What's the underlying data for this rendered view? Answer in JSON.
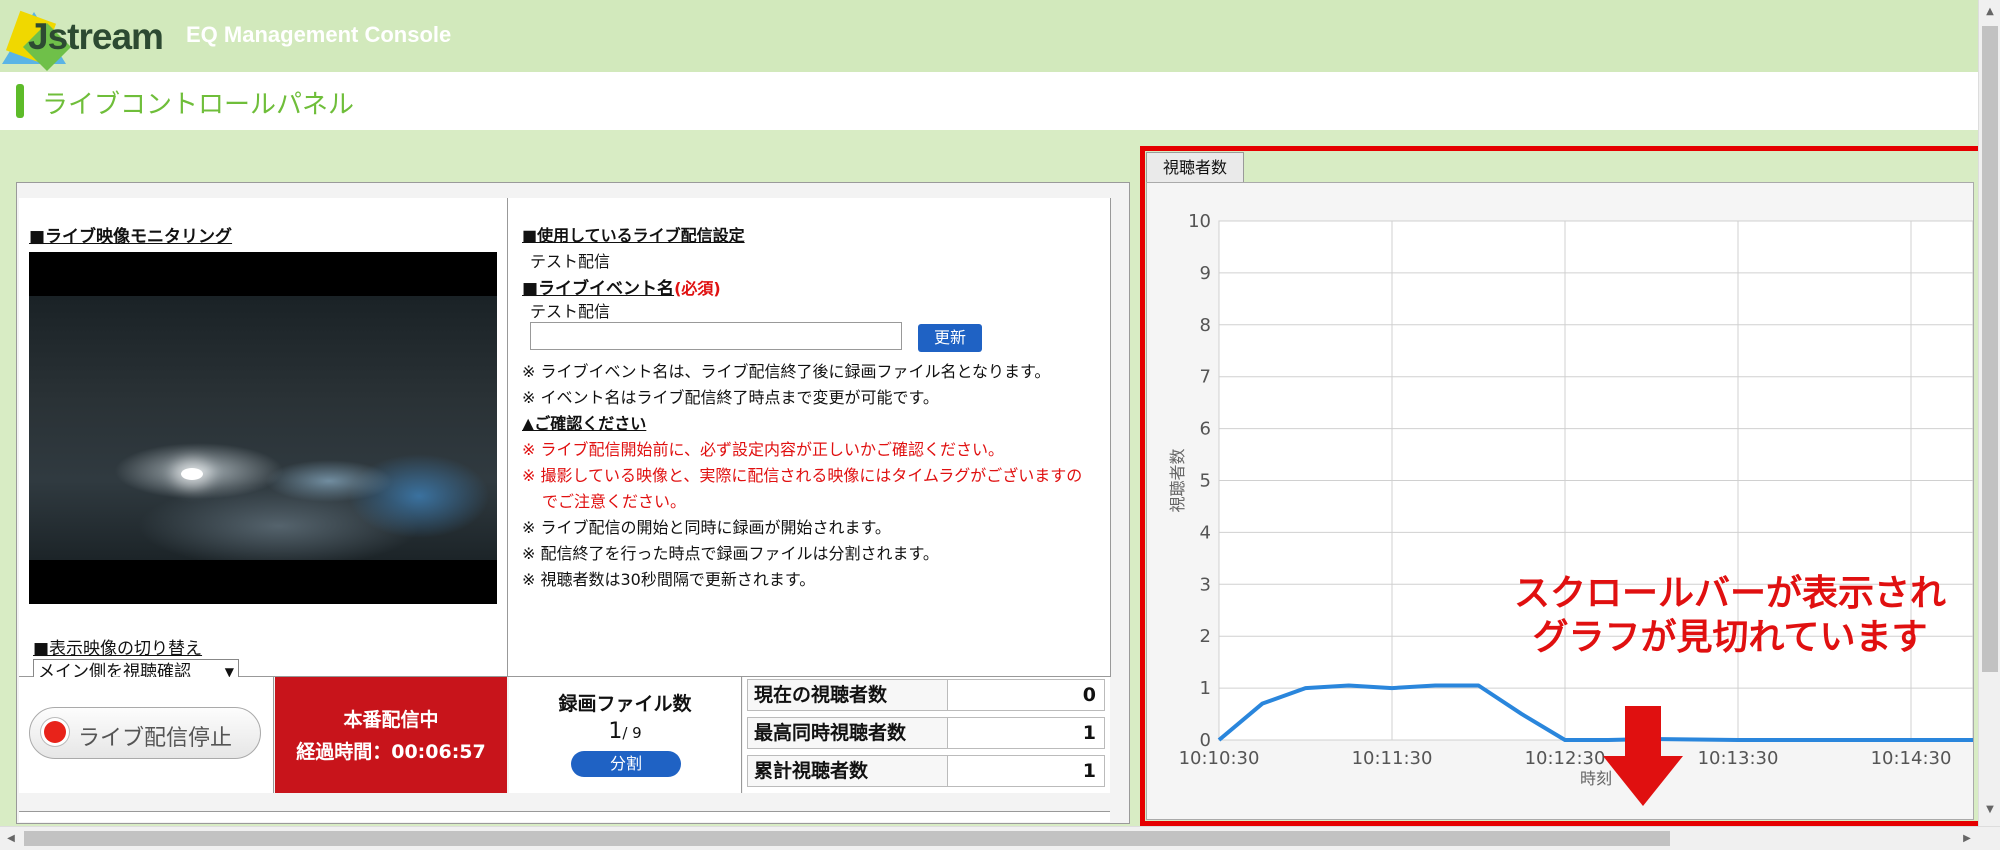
{
  "header": {
    "logo_text": "Jstream",
    "console_title": "EQ Management Console"
  },
  "page": {
    "title": "ライブコントロールパネル"
  },
  "monitor": {
    "title": "■ライブ映像モニタリング",
    "switch_label": "■表示映像の切り替え",
    "switch_value": "メイン側を視聴確認"
  },
  "settings": {
    "title": "■使用しているライブ配信設定",
    "setting_value": "テスト配信",
    "event_title": "■ライブイベント名",
    "required": "(必須)",
    "event_value": "テスト配信",
    "update_label": "更新",
    "note1": "※ ライブイベント名は、ライブ配信終了後に録画ファイル名となります。",
    "note2": "※ イベント名はライブ配信終了時点まで変更が可能です。",
    "confirm_title": "▲ご確認ください",
    "warn1": "※ ライブ配信開始前に、必ず設定内容が正しいかご確認ください。",
    "warn2a": "※ 撮影している映像と、実際に配信される映像にはタイムラグがございますの",
    "warn2b": "でご注意ください。",
    "info1": "※ ライブ配信の開始と同時に録画が開始されます。",
    "info2": "※ 配信終了を行った時点で録画ファイルは分割されます。",
    "info3": "※ 視聴者数は30秒間隔で更新されます。"
  },
  "controls": {
    "stop_label": "ライブ配信停止",
    "status_line1": "本番配信中",
    "status_line2": "経過時間：00:06:57",
    "rec_title": "録画ファイル数",
    "rec_current": "1",
    "rec_total": "/ 9",
    "split_label": "分割"
  },
  "stats": [
    {
      "label": "現在の視聴者数",
      "value": "0"
    },
    {
      "label": "最高同時視聴者数",
      "value": "1"
    },
    {
      "label": "累計視聴者数",
      "value": "1"
    }
  ],
  "chart_tab": "視聴者数",
  "annotation": {
    "line1": "スクロールバーが表示され",
    "line2": "グラフが見切れています"
  },
  "colors": {
    "accent_green": "#6fbe3a",
    "alert_red": "#e01010",
    "line_blue": "#2a86dc"
  },
  "chart_data": {
    "type": "line",
    "xlabel": "時刻",
    "ylabel": "視聴者数",
    "ylim": [
      0,
      10
    ],
    "yticks": [
      0,
      1,
      2,
      3,
      4,
      5,
      6,
      7,
      8,
      9,
      10
    ],
    "xticks": [
      "10:10:30",
      "10:11:30",
      "10:12:30",
      "10:13:30",
      "10:14:30"
    ],
    "series": [
      {
        "x": [
          "10:10:30",
          "10:10:45",
          "10:11:00",
          "10:11:15",
          "10:11:30",
          "10:11:45",
          "10:12:00",
          "10:12:15",
          "10:12:30",
          "10:12:45",
          "10:13:00",
          "10:13:30",
          "10:14:00",
          "10:14:30",
          "10:15:00"
        ],
        "values": [
          0,
          0.7,
          1.0,
          1.05,
          1.0,
          1.05,
          1.05,
          0.5,
          0,
          0,
          0.02,
          0,
          0,
          0,
          0
        ]
      }
    ]
  }
}
